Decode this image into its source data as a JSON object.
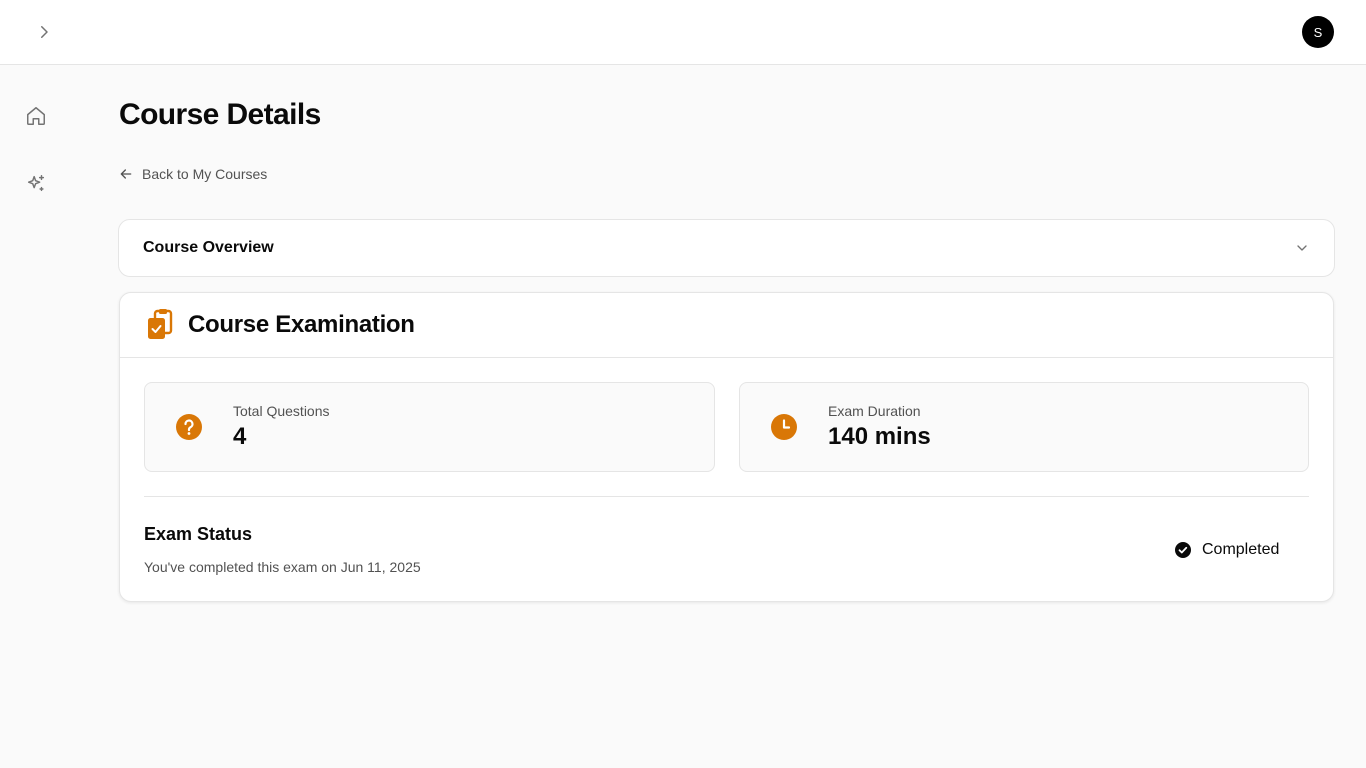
{
  "header": {
    "expand_icon": "chevron-right-icon",
    "avatar_initial": "S"
  },
  "sidebar": {
    "items": [
      {
        "icon": "home-icon"
      },
      {
        "icon": "sparkles-icon"
      }
    ]
  },
  "page": {
    "title": "Course Details",
    "back_label": "Back to My Courses"
  },
  "overview": {
    "title": "Course Overview",
    "icon": "chevron-down-icon"
  },
  "exam": {
    "title": "Course Examination",
    "icon": "clipboard-check-icon",
    "stats": [
      {
        "label": "Total Questions",
        "value": "4",
        "icon": "question-circle-icon"
      },
      {
        "label": "Exam Duration",
        "value": "140 mins",
        "icon": "clock-icon"
      }
    ],
    "status": {
      "title": "Exam Status",
      "description": "You've completed this exam on Jun 11, 2025",
      "badge": "Completed",
      "badge_icon": "check-circle-icon"
    }
  },
  "colors": {
    "accent": "#d97706",
    "text": "#0a0a0a",
    "muted": "#525252",
    "border": "#e5e5e5",
    "background": "#fafafa"
  }
}
